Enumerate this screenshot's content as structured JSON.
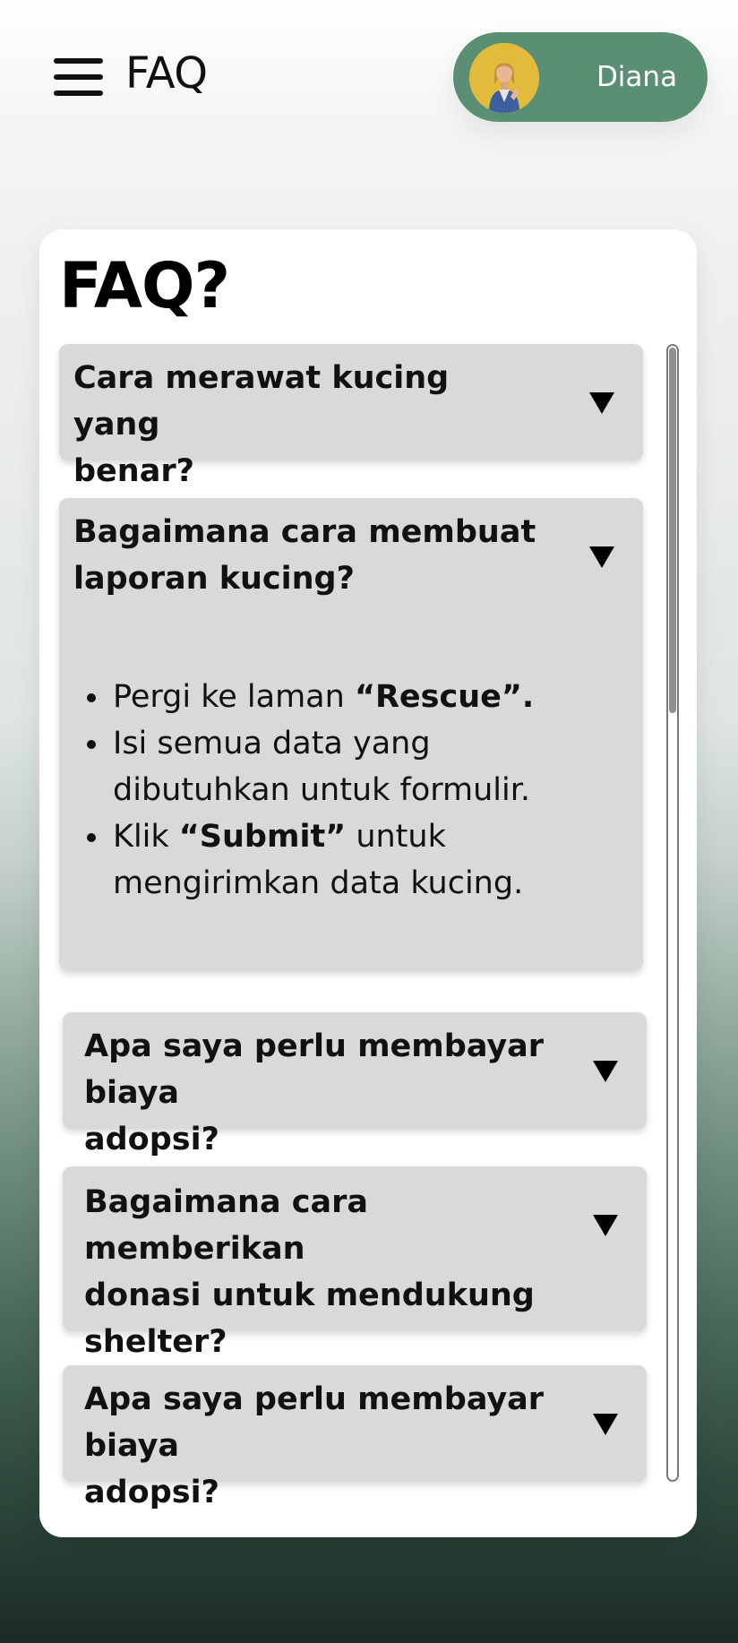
{
  "header": {
    "title": "FAQ",
    "user_name": "Diana"
  },
  "card": {
    "title": "FAQ?"
  },
  "faqs": [
    {
      "question_line1": "Cara merawat kucing yang",
      "question_line2": "benar?"
    },
    {
      "question_line1": "Bagaimana cara membuat",
      "question_line2": "laporan kucing?",
      "answer": {
        "step1_pre": "Pergi ke laman ",
        "step1_bold": "“Rescue”.",
        "step2": "Isi semua data yang dibutuhkan untuk formulir.",
        "step3_bold": "“Submit”",
        "step3_pre": "Klik ",
        "step3_post": " untuk mengirimkan data kucing."
      }
    },
    {
      "question_line1": "Apa saya perlu membayar biaya",
      "question_line2": "adopsi?"
    },
    {
      "question_line1": "Bagaimana cara memberikan",
      "question_line2": "donasi untuk mendukung",
      "question_line3": "shelter?"
    },
    {
      "question_line1": "Apa saya perlu membayar biaya",
      "question_line2": "adopsi?"
    }
  ],
  "colors": {
    "accent": "#5b8f74",
    "panel": "#d9d9d9"
  },
  "icons": {
    "menu": "hamburger-menu-icon",
    "expand": "triangle-down-icon"
  }
}
